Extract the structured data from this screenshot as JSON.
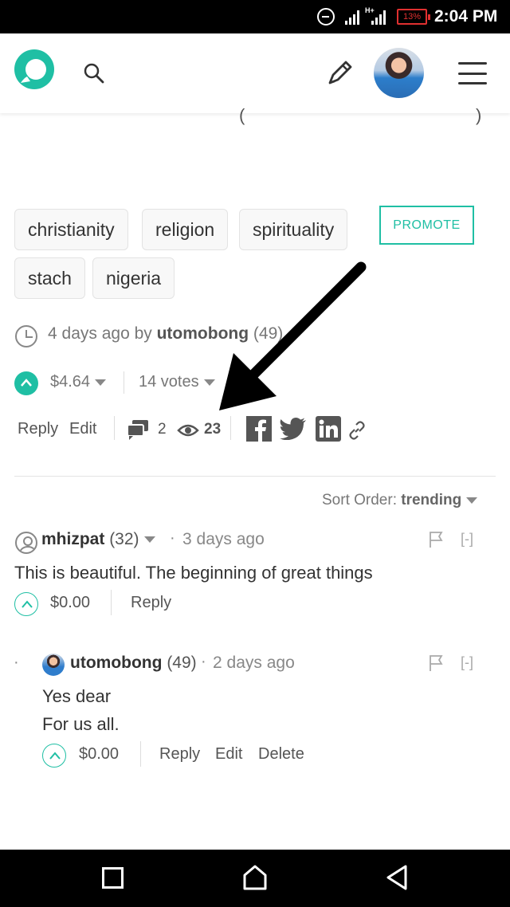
{
  "status_bar": {
    "battery": "13%",
    "time": "2:04 PM"
  },
  "post": {
    "tags": [
      "christianity",
      "religion",
      "spirituality",
      "stach",
      "nigeria"
    ],
    "promote_label": "PROMOTE",
    "age": "4 days ago by",
    "author": "utomobong",
    "author_rep": "(49)",
    "payout": "$4.64",
    "votes": "14 votes",
    "actions": {
      "reply": "Reply",
      "edit": "Edit"
    },
    "comment_count": "2",
    "view_count": "23"
  },
  "sort": {
    "label": "Sort Order:",
    "value": "trending"
  },
  "comments": [
    {
      "author": "mhizpat",
      "rep": "(32)",
      "time": "3 days ago",
      "body": "This is beautiful. The beginning of great things",
      "payout": "$0.00",
      "reply": "Reply",
      "collapse": "[-]"
    },
    {
      "author": "utomobong",
      "rep": "(49)",
      "time": "2 days ago",
      "body_line1": "Yes dear",
      "body_line2": "For us all.",
      "payout": "$0.00",
      "reply": "Reply",
      "edit": "Edit",
      "delete": "Delete",
      "collapse": "[-]"
    }
  ],
  "colors": {
    "accent": "#1fbfa4",
    "text": "#333333",
    "muted": "#777777"
  }
}
